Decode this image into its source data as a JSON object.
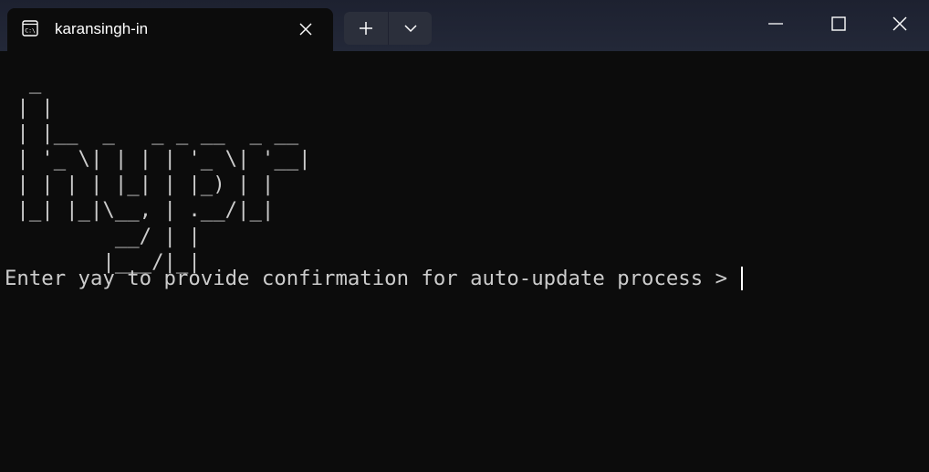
{
  "tab": {
    "title": "karansingh-in",
    "icon": "terminal-prompt-icon"
  },
  "toolbar": {
    "new_tab_icon": "plus-icon",
    "dropdown_icon": "chevron-down-icon"
  },
  "window_controls": {
    "minimize_icon": "minimize-icon",
    "maximize_icon": "maximize-icon",
    "close_icon": "close-icon"
  },
  "terminal": {
    "ascii_art": "  _\n | |\n | |__  _   _ _ __  _ __\n | '_ \\| | | | '_ \\| '__|\n | | | | |_| | |_) | |\n |_| |_|\\__, | .__/|_|\n         __/ | |\n        |___/|_|",
    "prompt": "Enter yay to provide confirmation for auto-update process > "
  },
  "colors": {
    "background": "#0c0c0c",
    "foreground": "#cccccc",
    "titlebar": "#1d2130"
  }
}
